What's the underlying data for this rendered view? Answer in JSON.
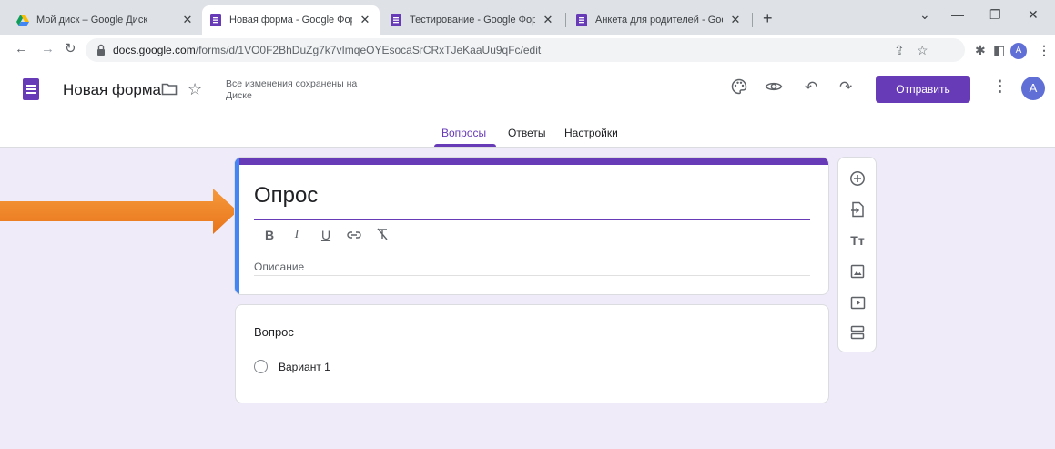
{
  "browser": {
    "tabs": [
      {
        "title": "Мой диск – Google Диск",
        "active": false,
        "favicon": "drive-icon"
      },
      {
        "title": "Новая форма - Google Формы",
        "active": true,
        "favicon": "forms-icon"
      },
      {
        "title": "Тестирование - Google Формы",
        "active": false,
        "favicon": "forms-icon"
      },
      {
        "title": "Анкета для родителей - Googl",
        "active": false,
        "favicon": "forms-icon"
      }
    ],
    "url_host": "docs.google.com",
    "url_path": "/forms/d/1VO0F2BhDuZg7k7vImqeOYEsocaSrCRxTJeKaaUu9qFc/edit",
    "profile_initial": "A"
  },
  "header": {
    "doc_title": "Новая форма",
    "save_status": "Все изменения сохранены на Диске",
    "send_label": "Отправить",
    "avatar_initial": "A"
  },
  "form_tabs": [
    "Вопросы",
    "Ответы",
    "Настройки"
  ],
  "title_card": {
    "title": "Опрос",
    "format_tools": [
      "B",
      "I",
      "U",
      "link",
      "clear-format"
    ],
    "description_placeholder": "Описание"
  },
  "question": {
    "title": "Вопрос",
    "option_label": "Вариант 1"
  },
  "sidebar_tools": [
    "add-question-icon",
    "import-questions-icon",
    "add-title-icon",
    "add-image-icon",
    "add-video-icon",
    "add-section-icon"
  ],
  "colors": {
    "accent": "#673ab7",
    "page_bg": "#f0ebf8",
    "focus_bar": "#4285f4",
    "arrow": "#f0841f"
  }
}
